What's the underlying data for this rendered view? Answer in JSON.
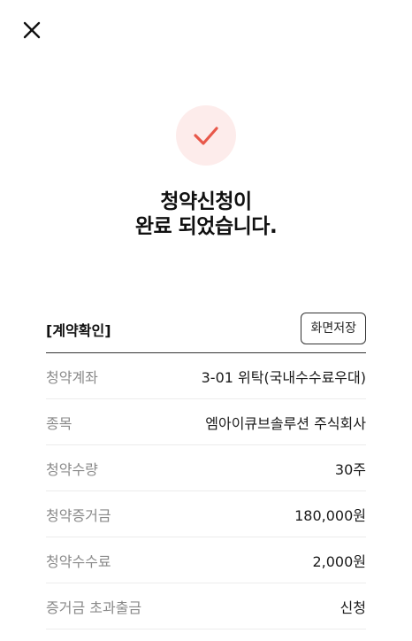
{
  "header": {
    "close_icon": "close-icon"
  },
  "result": {
    "icon": "check-icon",
    "accent_color": "#e8584a",
    "icon_bg_color": "#fdeceb",
    "title_line1": "청약신청이",
    "title_line2": "완료 되었습니다."
  },
  "contract": {
    "section_title": "[계약확인]",
    "save_button_label": "화면저장",
    "rows": [
      {
        "label": "청약계좌",
        "value": "3-01 위탁(국내수수료우대)"
      },
      {
        "label": "종목",
        "value": "엠아이큐브솔루션 주식회사"
      },
      {
        "label": "청약수량",
        "value": "30주"
      },
      {
        "label": "청약증거금",
        "value": "180,000원"
      },
      {
        "label": "청약수수료",
        "value": "2,000원"
      },
      {
        "label": "증거금 초과출금",
        "value": "신청"
      }
    ]
  }
}
